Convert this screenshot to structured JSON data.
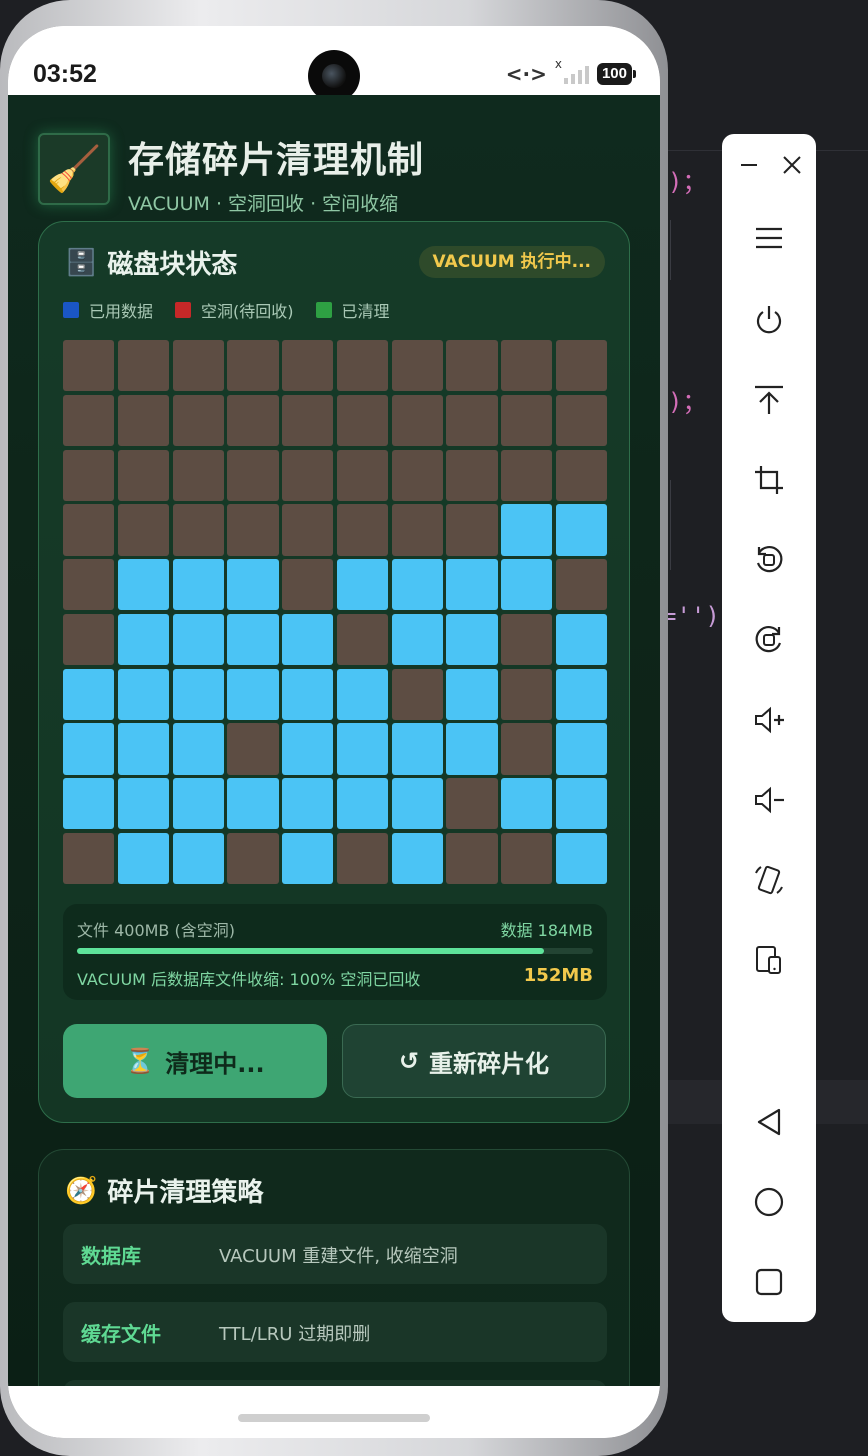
{
  "status_bar": {
    "time": "03:52",
    "network_code": "<·>",
    "network_x": "x",
    "battery": "100"
  },
  "header": {
    "logo_emoji": "🧹",
    "title": "存储碎片清理机制",
    "subtitle": "VACUUM · 空洞回收 · 空间收缩"
  },
  "disk_card": {
    "icon": "🗄️",
    "title": "磁盘块状态",
    "badge": "VACUUM 执行中...",
    "legend": [
      {
        "label": "已用数据",
        "color": "#1a56c4"
      },
      {
        "label": "空洞(待回收)",
        "color": "#c62828"
      },
      {
        "label": "已清理",
        "color": "#2ea043"
      }
    ],
    "grid_rows": [
      "HHHHHHHHHH",
      "HHHHHHHHHH",
      "HHHHHHHHHH",
      "HHHHHHHHUU",
      "HUUUHUUUUH",
      "HUUUUHUUHU",
      "UUUUUUHUHU",
      "UUUHUUUUHU",
      "UUUUUUUHUU",
      "HUUHUHUHHU"
    ],
    "cell_colors": {
      "H": "#5d4d43",
      "U": "#4bc4f5"
    },
    "stats": {
      "file_label": "文件 400MB (含空洞)",
      "data_label": "数据 184MB",
      "progress": 0.905,
      "result_text": "VACUUM 后数据库文件收缩: 100% 空洞已回收",
      "result_size": "152MB"
    },
    "buttons": {
      "primary_icon": "⏳",
      "primary_label": "清理中...",
      "secondary_icon": "↺",
      "secondary_label": "重新碎片化"
    }
  },
  "strategy_card": {
    "icon": "🧭",
    "title": "碎片清理策略",
    "rows": [
      {
        "key": "数据库",
        "value": "VACUUM 重建文件, 收缩空洞"
      },
      {
        "key": "缓存文件",
        "value": "TTL/LRU 过期即删"
      },
      {
        "key": "",
        "value": ""
      }
    ]
  },
  "editor": {
    "fragments": [
      ")；",
      ")；",
      "='');"
    ]
  }
}
